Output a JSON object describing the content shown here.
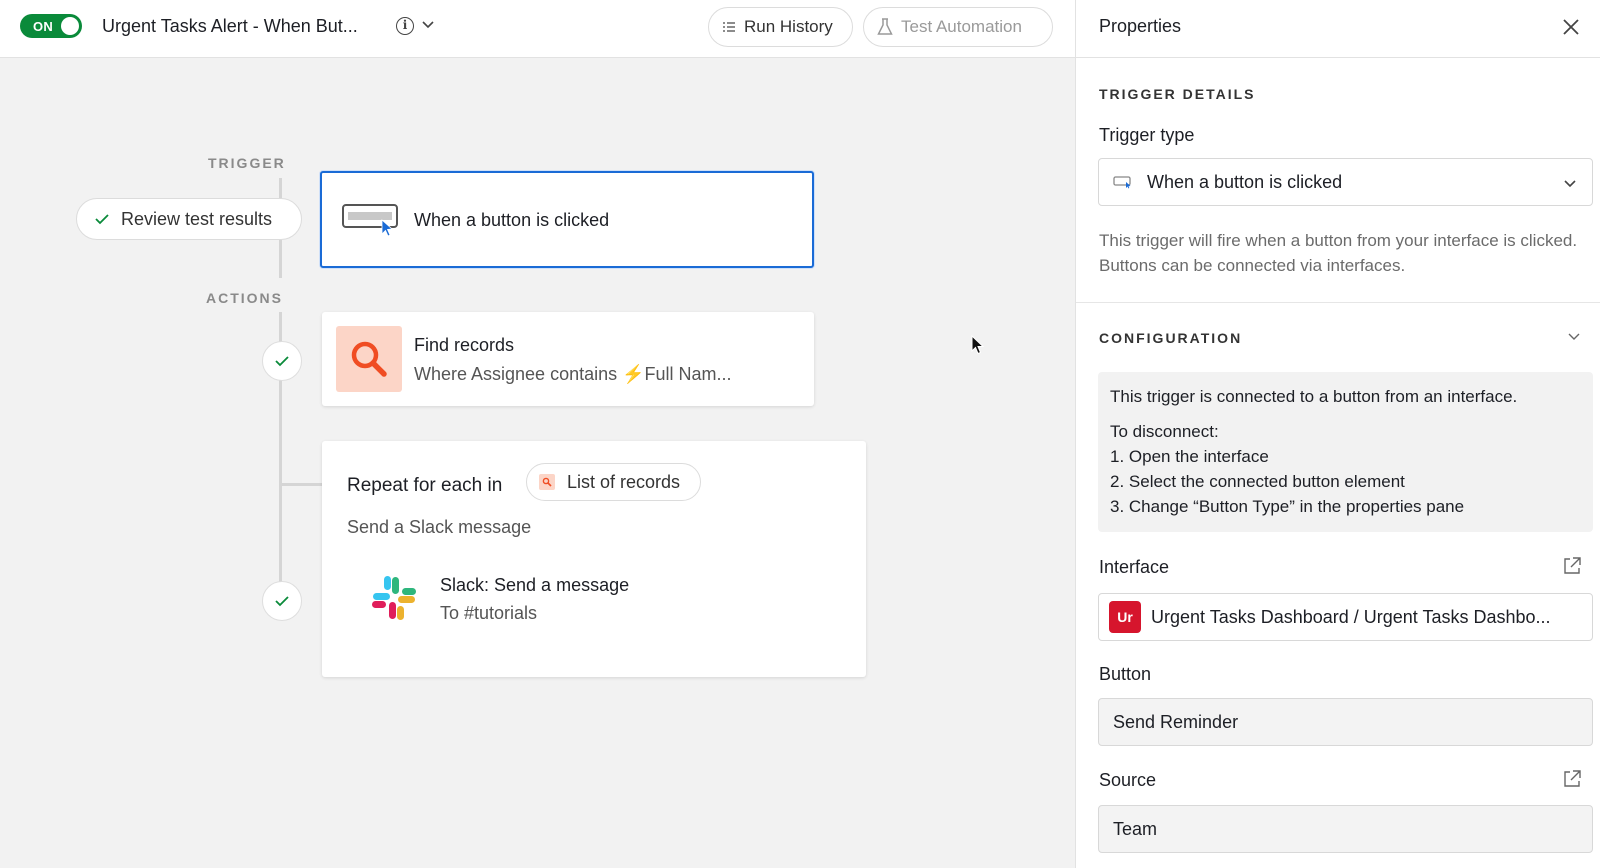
{
  "topbar": {
    "toggle_label": "ON",
    "title": "Urgent Tasks Alert - When But...",
    "info_glyph": "i",
    "run_history_label": "Run History",
    "test_automation_label": "Test Automation"
  },
  "flow": {
    "trigger_label": "TRIGGER",
    "actions_label": "ACTIONS",
    "review_label": "Review test results",
    "trigger_card": {
      "title": "When a button is clicked"
    },
    "find_card": {
      "title": "Find records",
      "subtitle": "Where Assignee contains ⚡Full Nam..."
    },
    "repeat_card": {
      "title": "Repeat for each in",
      "list_label": "List of records",
      "subtitle": "Send a Slack message",
      "slack_title": "Slack: Send a message",
      "slack_subtitle": "To #tutorials"
    }
  },
  "panel": {
    "title": "Properties",
    "trigger_details_label": "TRIGGER DETAILS",
    "trigger_type_label": "Trigger type",
    "trigger_type_value": "When a button is clicked",
    "trigger_description": "This trigger will fire when a button from your interface is clicked. Buttons can be connected via interfaces.",
    "configuration_label": "CONFIGURATION",
    "config_intro": "This trigger is connected to a button from an interface.",
    "config_disconnect": "To disconnect:",
    "config_steps": [
      "1. Open the interface",
      "2. Select the connected button element",
      "3. Change “Button Type” in the properties pane"
    ],
    "interface_label": "Interface",
    "interface_badge": "Ur",
    "interface_value": "Urgent Tasks Dashboard / Urgent Tasks Dashbo...",
    "button_label": "Button",
    "button_value": "Send Reminder",
    "source_label": "Source",
    "source_value": "Team"
  },
  "colors": {
    "toggle_on": "#0a8a3a",
    "selected_border": "#1a6bd6",
    "interface_badge": "#d6152d",
    "find_icon_bg": "#fcd5c7",
    "find_icon_fg": "#f04d23"
  }
}
